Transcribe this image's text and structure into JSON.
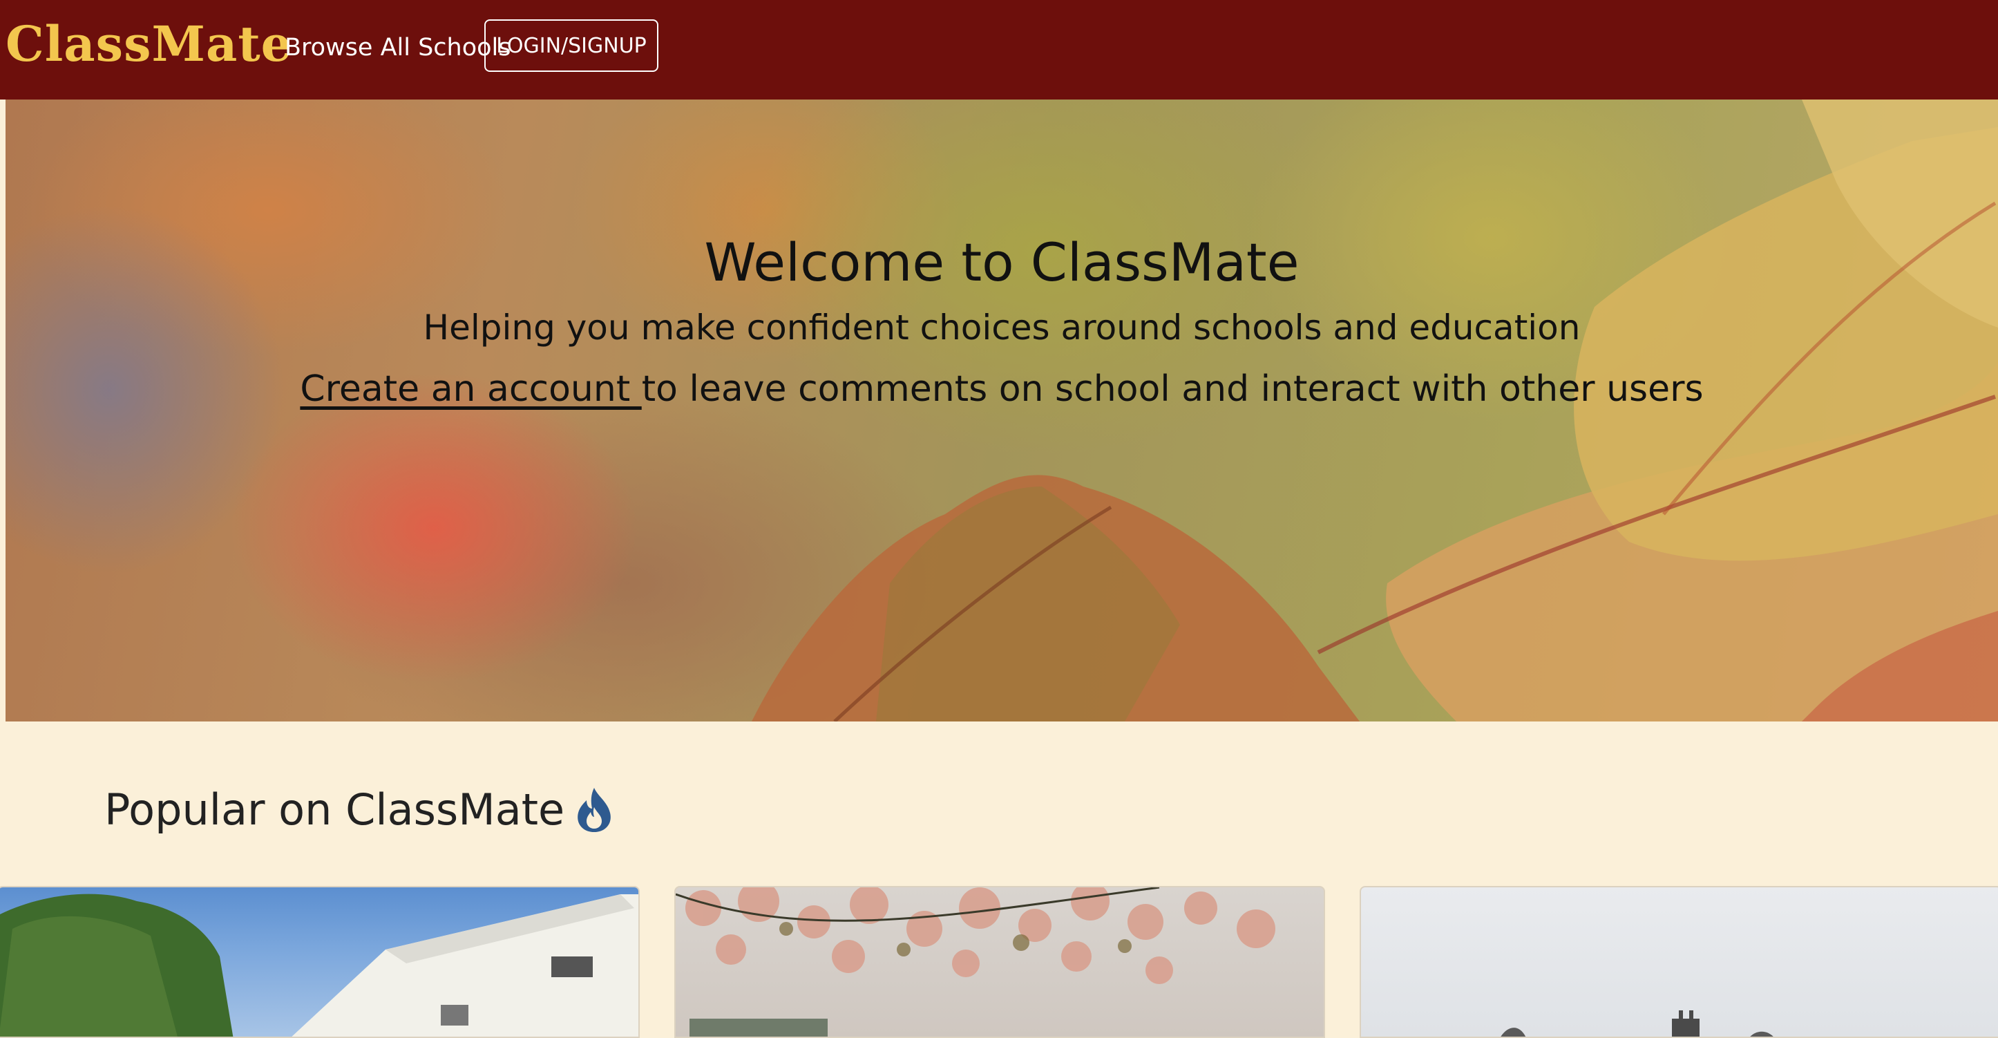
{
  "navbar": {
    "brand": "ClassMate",
    "browse_label": "Browse All Schools",
    "login_label": "LOGIN/SIGNUP"
  },
  "hero": {
    "title": "Welcome to ClassMate",
    "subtitle": "Helping you make confident choices around schools and education",
    "cta_link": "Create an account ",
    "cta_text": "to leave comments on school and interact with other users"
  },
  "popular": {
    "heading": "Popular on ClassMate",
    "icon": "flame-icon",
    "cards": [
      {
        "image": "school-building-photo"
      },
      {
        "image": "blossom-tree-photo"
      },
      {
        "image": "castle-photo"
      }
    ]
  },
  "colors": {
    "navbar_bg": "#6d0f0c",
    "brand": "#f3c64e",
    "page_bg": "#fbf0d9",
    "flame": "#2e5a8f"
  }
}
